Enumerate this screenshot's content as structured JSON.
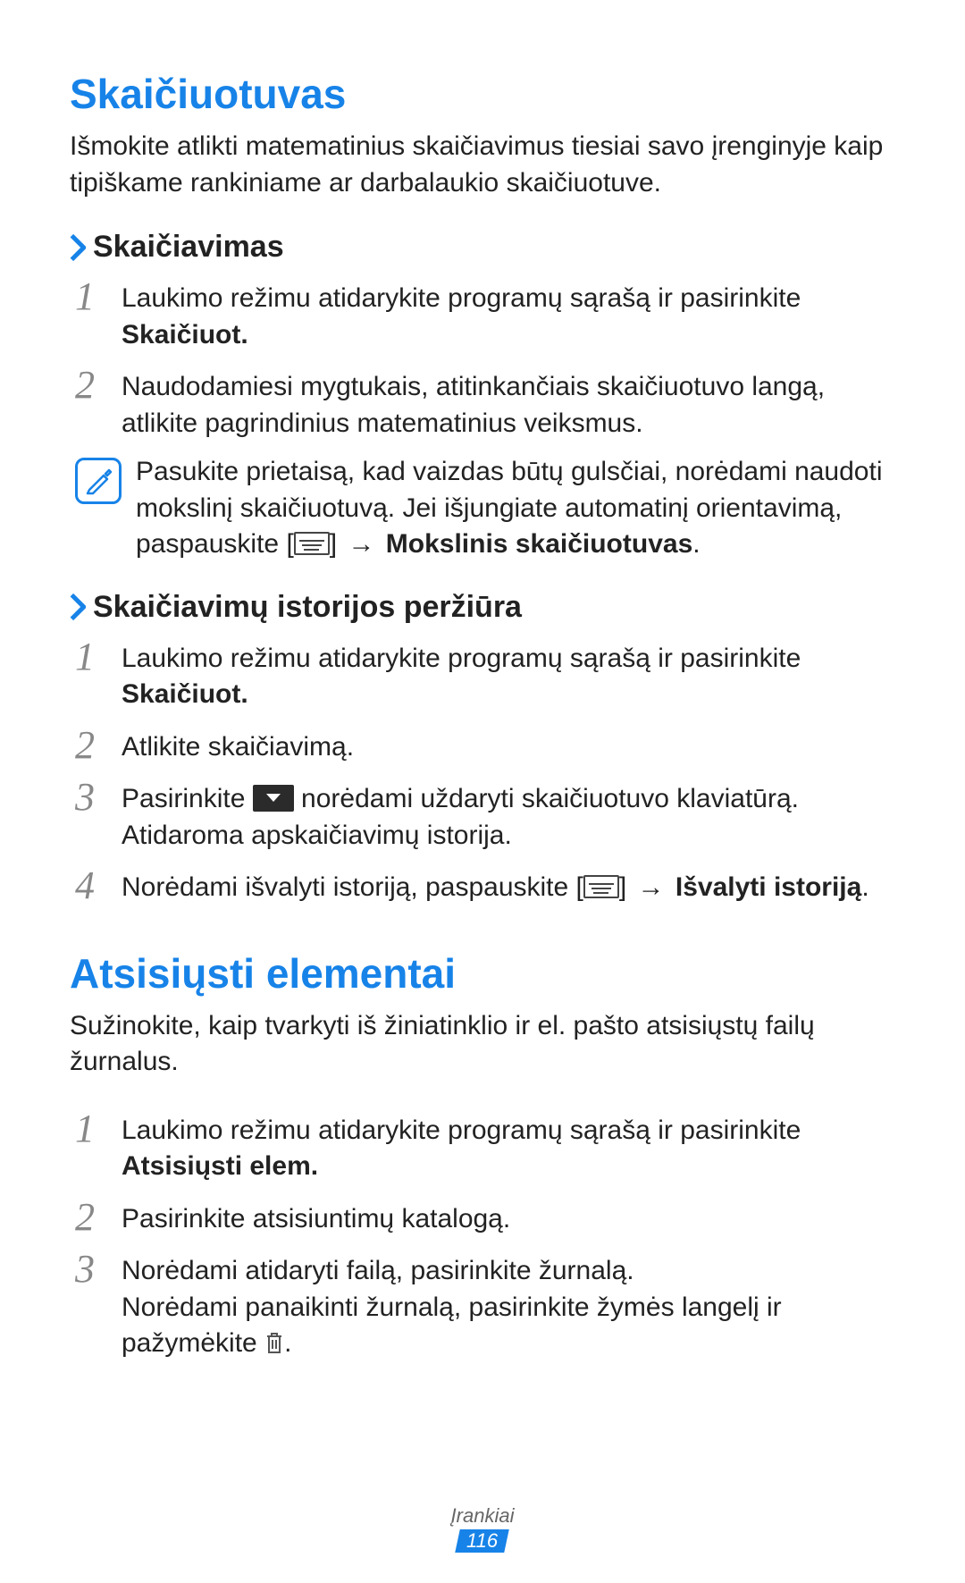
{
  "section1": {
    "title": "Skaičiuotuvas",
    "intro": "Išmokite atlikti matematinius skaičiavimus tiesiai savo įrenginyje kaip tipiškame rankiniame ar darbalaukio skaičiuotuve.",
    "sub1_title": "Skaičiavimas",
    "s1": {
      "n": "1",
      "t1": "Laukimo režimu atidarykite programų sąrašą ir pasirinkite ",
      "t2": "Skaičiuot."
    },
    "s2": {
      "n": "2",
      "t1": "Naudodamiesi mygtukais, atitinkančiais skaičiuotuvo langą, atlikite pagrindinius matematinius veiksmus."
    },
    "note": {
      "t1": "Pasukite prietaisą, kad vaizdas būtų gulsčiai, norėdami naudoti mokslinį skaičiuotuvą. Jei išjungiate automatinį orientavimą, paspauskite [",
      "t2": "] ",
      "arrow": "→",
      "t3": " Mokslinis skaičiuotuvas",
      "period": "."
    },
    "sub2_title": "Skaičiavimų istorijos peržiūra",
    "h1": {
      "n": "1",
      "t1": "Laukimo režimu atidarykite programų sąrašą ir pasirinkite ",
      "t2": "Skaičiuot."
    },
    "h2": {
      "n": "2",
      "t1": "Atlikite skaičiavimą."
    },
    "h3": {
      "n": "3",
      "t1": "Pasirinkite ",
      "t2": " norėdami uždaryti skaičiuotuvo klaviatūrą. Atidaroma apskaičiavimų istorija."
    },
    "h4": {
      "n": "4",
      "t1": "Norėdami išvalyti istoriją, paspauskite [",
      "t2": "] ",
      "arrow": "→",
      "t3": " Išvalyti istoriją",
      "period": "."
    }
  },
  "section2": {
    "title": "Atsisiųsti elementai",
    "intro": "Sužinokite, kaip tvarkyti iš žiniatinklio ir el. pašto atsisiųstų failų žurnalus.",
    "s1": {
      "n": "1",
      "t1": "Laukimo režimu atidarykite programų sąrašą ir pasirinkite ",
      "t2": "Atsisiųsti elem."
    },
    "s2": {
      "n": "2",
      "t1": "Pasirinkite atsisiuntimų katalogą."
    },
    "s3": {
      "n": "3",
      "t1": "Norėdami atidaryti failą, pasirinkite žurnalą.",
      "t2": "Norėdami panaikinti žurnalą, pasirinkite žymės langelį ir pažymėkite ",
      "period": "."
    }
  },
  "footer": {
    "label": "Įrankiai",
    "page": "116"
  }
}
